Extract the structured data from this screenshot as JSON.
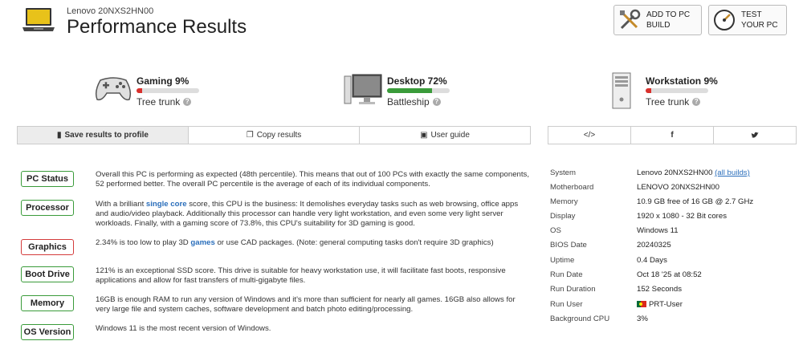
{
  "header": {
    "model": "Lenovo 20NXS2HN00",
    "title": "Performance Results",
    "add_to_pc_label_1": "ADD TO PC",
    "add_to_pc_label_2": "BUILD",
    "test_label_1": "TEST",
    "test_label_2": "YOUR PC"
  },
  "categories": [
    {
      "name": "Gaming",
      "percent": "9%",
      "value": 9,
      "label": "Gaming 9%",
      "rating": "Tree trunk",
      "icon": "gamepad-icon",
      "color": "#d9302c"
    },
    {
      "name": "Desktop",
      "percent": "72%",
      "value": 72,
      "label": "Desktop 72%",
      "rating": "Battleship",
      "icon": "monitor-icon",
      "color": "#3a9b3a"
    },
    {
      "name": "Workstation",
      "percent": "9%",
      "value": 9,
      "label": "Workstation 9%",
      "rating": "Tree trunk",
      "icon": "tower-pc-icon",
      "color": "#d9302c"
    }
  ],
  "actions": {
    "save": "Save results to profile",
    "copy": "Copy results",
    "guide": "User guide"
  },
  "share": {
    "embed": "</>",
    "facebook": "f",
    "twitter": "♥"
  },
  "status": [
    {
      "label": "PC Status",
      "state": "good",
      "text": "Overall this PC is performing as expected (48th percentile). This means that out of 100 PCs with exactly the same components, 52 performed better. The overall PC percentile is the average of each of its individual components."
    },
    {
      "label": "Processor",
      "state": "good",
      "text_before": "With a brilliant ",
      "link": "single core",
      "text_after": " score, this CPU is the business: It demolishes everyday tasks such as web browsing, office apps and audio/video playback. Additionally this processor can handle very light workstation, and even some very light server workloads. Finally, with a gaming score of 73.8%, this CPU's suitability for 3D gaming is good."
    },
    {
      "label": "Graphics",
      "state": "bad",
      "text_before": "2.34% is too low to play 3D ",
      "link": "games",
      "text_after": " or use CAD packages. (Note: general computing tasks don't require 3D graphics)"
    },
    {
      "label": "Boot Drive",
      "state": "good",
      "text": "121% is an exceptional SSD score. This drive is suitable for heavy workstation use, it will facilitate fast boots, responsive applications and allow for fast transfers of multi-gigabyte files."
    },
    {
      "label": "Memory",
      "state": "good",
      "text": "16GB is enough RAM to run any version of Windows and it's more than sufficient for nearly all games. 16GB also allows for very large file and system caches, software development and batch photo editing/processing."
    },
    {
      "label": "OS Version",
      "state": "good",
      "text": "Windows 11 is the most recent version of Windows."
    }
  ],
  "system_info": [
    {
      "key": "System",
      "value": "Lenovo 20NXS2HN00",
      "link": "(all builds)"
    },
    {
      "key": "Motherboard",
      "value": "LENOVO 20NXS2HN00"
    },
    {
      "key": "Memory",
      "value": "10.9 GB free of 16 GB @ 2.7 GHz"
    },
    {
      "key": "Display",
      "value": "1920 x 1080 - 32 Bit cores"
    },
    {
      "key": "OS",
      "value": "Windows 11"
    },
    {
      "key": "BIOS Date",
      "value": "20240325"
    },
    {
      "key": "Uptime",
      "value": "0.4 Days"
    },
    {
      "key": "Run Date",
      "value": "Oct 18 '25 at 08:52"
    },
    {
      "key": "Run Duration",
      "value": "152 Seconds"
    },
    {
      "key": "Run User",
      "value": "PRT-User",
      "flag": "portugal-flag-icon"
    },
    {
      "key": "Background CPU",
      "value": "3%"
    }
  ]
}
